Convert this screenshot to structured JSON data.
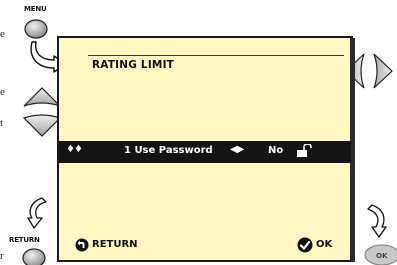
{
  "remote": {
    "menu_label": "MENU",
    "return_label": "RETURN",
    "ok_label": "OK"
  },
  "screen": {
    "title": "RATING LIMIT",
    "selected_item": {
      "nav_glyph": "♦♦",
      "label": "1 Use Password",
      "lr_glyph": "◀▶",
      "value": "No",
      "lock_state": "unlocked"
    },
    "footer": {
      "return_label": "RETURN",
      "ok_label": "OK"
    }
  },
  "edge_text": [
    "e",
    "e",
    "t",
    "r"
  ],
  "colors": {
    "screen_bg": "#fff8c4",
    "bar_bg": "#141414",
    "button_fill": "#b8b8b8"
  }
}
